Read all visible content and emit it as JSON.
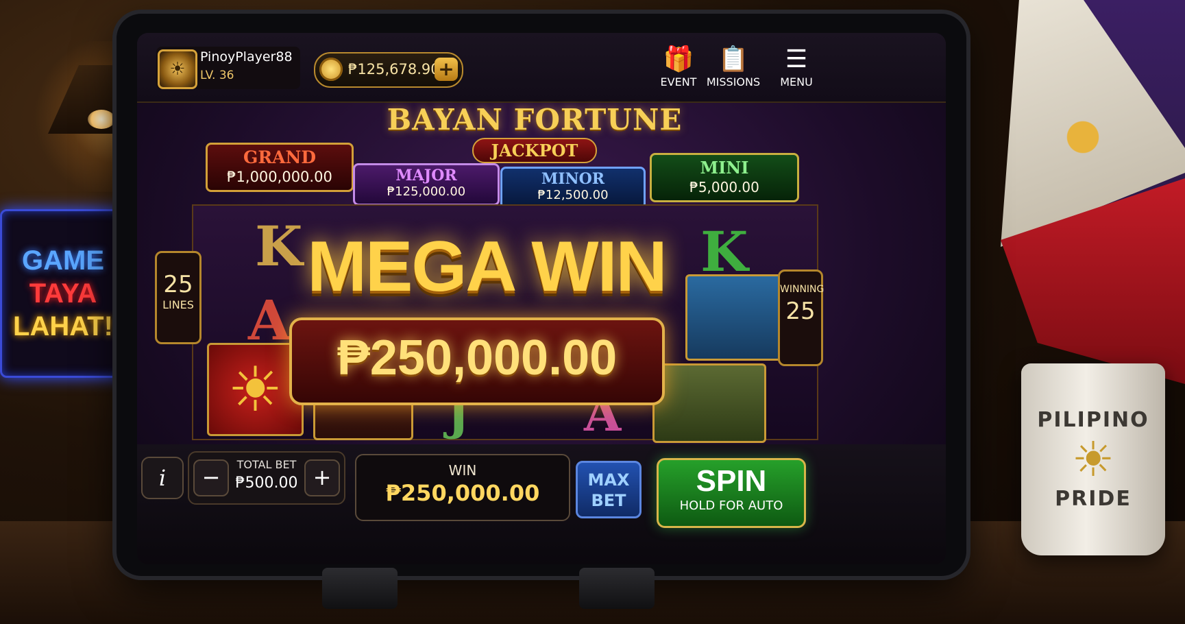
{
  "scene": {
    "neon_sign": [
      "GAME",
      "TAYA",
      "LAHAT!"
    ],
    "mug_text": [
      "PILIPINO",
      "PRIDE"
    ]
  },
  "player": {
    "name": "PinoyPlayer88",
    "level": "LV. 36"
  },
  "wallet": {
    "balance": "₱125,678.90",
    "add_label": "+"
  },
  "nav": {
    "event": "EVENT",
    "missions": "MISSIONS",
    "menu": "MENU"
  },
  "game": {
    "title": "BAYAN FORTUNE",
    "subtitle": "JACKPOT"
  },
  "jackpots": {
    "grand": {
      "name": "GRAND",
      "amount": "₱1,000,000.00"
    },
    "major": {
      "name": "MAJOR",
      "amount": "₱125,000.00"
    },
    "minor": {
      "name": "MINOR",
      "amount": "₱12,500.00"
    },
    "mini": {
      "name": "MINI",
      "amount": "₱5,000.00"
    }
  },
  "reels": {
    "symbols": {
      "k1": "K",
      "a1": "A",
      "k2": "K",
      "j": "J",
      "a2": "A"
    }
  },
  "lines": {
    "count": "25",
    "label": "LINES"
  },
  "winning": {
    "label": "WINNING",
    "count": "25"
  },
  "mega_win": {
    "label": "MEGA WIN",
    "amount": "₱250,000.00"
  },
  "controls": {
    "info": "i",
    "bet_minus": "−",
    "bet_plus": "+",
    "total_bet_label": "TOTAL BET",
    "total_bet": "₱500.00",
    "win_label": "WIN",
    "win_value": "₱250,000.00",
    "max_bet": [
      "MAX",
      "BET"
    ],
    "spin": "SPIN",
    "spin_hint": "HOLD FOR AUTO"
  },
  "colors": {
    "gold": "#ffd24a",
    "spin_green": "#26a02a",
    "max_bet_blue": "#2251b0"
  }
}
